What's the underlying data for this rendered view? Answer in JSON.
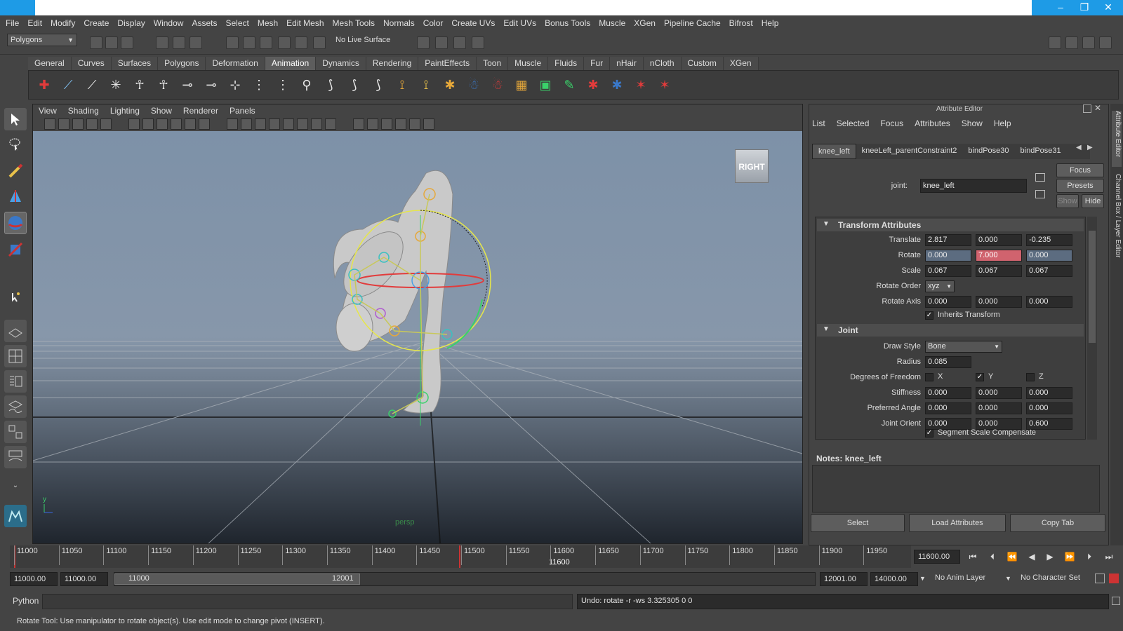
{
  "window": {
    "minimize": "–",
    "restore": "❐",
    "close": "✕"
  },
  "menu": [
    "File",
    "Edit",
    "Modify",
    "Create",
    "Display",
    "Window",
    "Assets",
    "Select",
    "Mesh",
    "Edit Mesh",
    "Mesh Tools",
    "Normals",
    "Color",
    "Create UVs",
    "Edit UVs",
    "Bonus Tools",
    "Muscle",
    "XGen",
    "Pipeline Cache",
    "Bifrost",
    "Help"
  ],
  "status": {
    "mode": "Polygons",
    "live_surface": "No Live Surface"
  },
  "shelf_tabs": [
    "General",
    "Curves",
    "Surfaces",
    "Polygons",
    "Deformation",
    "Animation",
    "Dynamics",
    "Rendering",
    "PaintEffects",
    "Toon",
    "Muscle",
    "Fluids",
    "Fur",
    "nHair",
    "nCloth",
    "Custom",
    "XGen"
  ],
  "shelf_active": "Animation",
  "viewport": {
    "menu": [
      "View",
      "Shading",
      "Lighting",
      "Show",
      "Renderer",
      "Panels"
    ],
    "cube_label": "RIGHT",
    "camera_label": "persp",
    "axis_y": "y"
  },
  "attr": {
    "title": "Attribute Editor",
    "menu": [
      "List",
      "Selected",
      "Focus",
      "Attributes",
      "Show",
      "Help"
    ],
    "tabs": [
      "knee_left",
      "kneeLeft_parentConstraint2",
      "bindPose30",
      "bindPose31"
    ],
    "node_label": "joint:",
    "node_value": "knee_left",
    "focus": "Focus",
    "presets": "Presets",
    "show": "Show",
    "hide": "Hide",
    "transform_header": "Transform Attributes",
    "translate_label": "Translate",
    "translate": [
      "2.817",
      "0.000",
      "-0.235"
    ],
    "rotate_label": "Rotate",
    "rotate": [
      "0.000",
      "7.000",
      "0.000"
    ],
    "scale_label": "Scale",
    "scale": [
      "0.067",
      "0.067",
      "0.067"
    ],
    "rotate_order_label": "Rotate Order",
    "rotate_order": "xyz",
    "rotate_axis_label": "Rotate Axis",
    "rotate_axis": [
      "0.000",
      "0.000",
      "0.000"
    ],
    "inherits": "Inherits Transform",
    "joint_header": "Joint",
    "draw_style_label": "Draw Style",
    "draw_style": "Bone",
    "radius_label": "Radius",
    "radius": "0.085",
    "dof_label": "Degrees of Freedom",
    "dof": [
      "X",
      "Y",
      "Z"
    ],
    "stiffness_label": "Stiffness",
    "stiffness": [
      "0.000",
      "0.000",
      "0.000"
    ],
    "preferred_label": "Preferred Angle",
    "preferred": [
      "0.000",
      "0.000",
      "0.000"
    ],
    "orient_label": "Joint Orient",
    "orient": [
      "0.000",
      "0.000",
      "0.600"
    ],
    "segment": "Segment Scale Compensate",
    "notes_label": "Notes:",
    "notes_value": "knee_left",
    "select": "Select",
    "load": "Load Attributes",
    "copy": "Copy Tab"
  },
  "side_tabs": [
    "Attribute Editor",
    "Channel Box / Layer Editor"
  ],
  "timeline": {
    "ticks": [
      "11000",
      "11050",
      "11100",
      "11150",
      "11200",
      "11250",
      "11300",
      "11350",
      "11400",
      "11450",
      "11500",
      "11550",
      "11600",
      "11650",
      "11700",
      "11750",
      "11800",
      "11850",
      "11900",
      "11950"
    ],
    "current_label": "11600",
    "current_frame": "11600.00"
  },
  "range": {
    "start": "11000.00",
    "range_start": "11000.00",
    "slider_start": "11000",
    "slider_end": "12001",
    "range_end": "12001.00",
    "end": "14000.00",
    "anim_layer": "No Anim Layer",
    "char_set": "No Character Set"
  },
  "cmd": {
    "lang": "Python",
    "result": "Undo: rotate -r -ws 3.325305 0 0"
  },
  "help": "Rotate Tool: Use manipulator to rotate object(s). Use edit mode to change pivot (INSERT)."
}
